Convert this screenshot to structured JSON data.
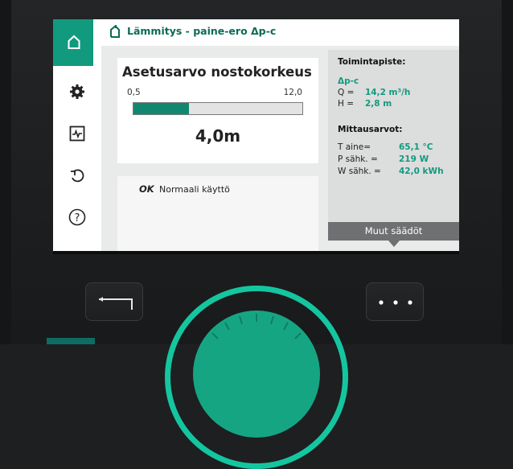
{
  "header": {
    "title": "Lämmitys - paine-ero Δp-c"
  },
  "sidebar": {
    "items": [
      {
        "name": "home",
        "icon": "home-icon",
        "active": true
      },
      {
        "name": "settings",
        "icon": "gear-icon",
        "active": false
      },
      {
        "name": "diagnostics",
        "icon": "pulse-monitor-icon",
        "active": false
      },
      {
        "name": "restore",
        "icon": "undo-icon",
        "active": false
      },
      {
        "name": "help",
        "icon": "help-icon",
        "active": false
      }
    ]
  },
  "setpoint": {
    "title": "Asetusarvo nostokorkeus",
    "min": "0,5",
    "max": "12,0",
    "value": "4,0m",
    "fill_fraction": 0.33
  },
  "status": {
    "code": "OK",
    "text": "Normaali käyttö"
  },
  "operating_point": {
    "heading": "Toimintapiste:",
    "mode": "Δp-c",
    "q_label": "Q =",
    "q_value": "14,2 m³/h",
    "h_label": "H =",
    "h_value": "2,8 m"
  },
  "measurements": {
    "heading": "Mittausarvot:",
    "rows": [
      {
        "label": "T aine=",
        "value": "65,1 °C"
      },
      {
        "label": "P sähk. =",
        "value": "219 W"
      },
      {
        "label": "W sähk. =",
        "value": "42,0 kWh"
      }
    ]
  },
  "more_settings": {
    "label": "Muut säädöt"
  },
  "colors": {
    "accent": "#129a7f",
    "title_text": "#0b6b54",
    "dial_ring": "#14c6a0"
  }
}
